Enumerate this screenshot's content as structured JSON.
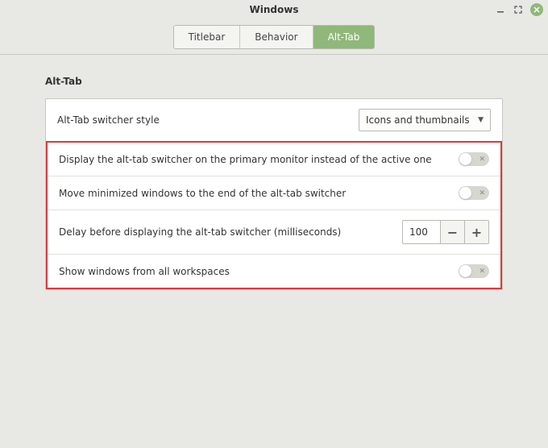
{
  "window": {
    "title": "Windows"
  },
  "tabs": {
    "items": [
      {
        "label": "Titlebar"
      },
      {
        "label": "Behavior"
      },
      {
        "label": "Alt-Tab"
      }
    ],
    "activeIndex": 2
  },
  "section": {
    "title": "Alt-Tab"
  },
  "rows": {
    "style": {
      "label": "Alt-Tab switcher style",
      "value": "Icons and thumbnails"
    },
    "primaryMonitor": {
      "label": "Display the alt-tab switcher on the primary monitor instead of the active one",
      "enabled": false
    },
    "moveMinimized": {
      "label": "Move minimized windows to the end of the alt-tab switcher",
      "enabled": false
    },
    "delay": {
      "label": "Delay before displaying the alt-tab switcher (milliseconds)",
      "value": "100"
    },
    "allWorkspaces": {
      "label": "Show windows from all workspaces",
      "enabled": false
    }
  }
}
